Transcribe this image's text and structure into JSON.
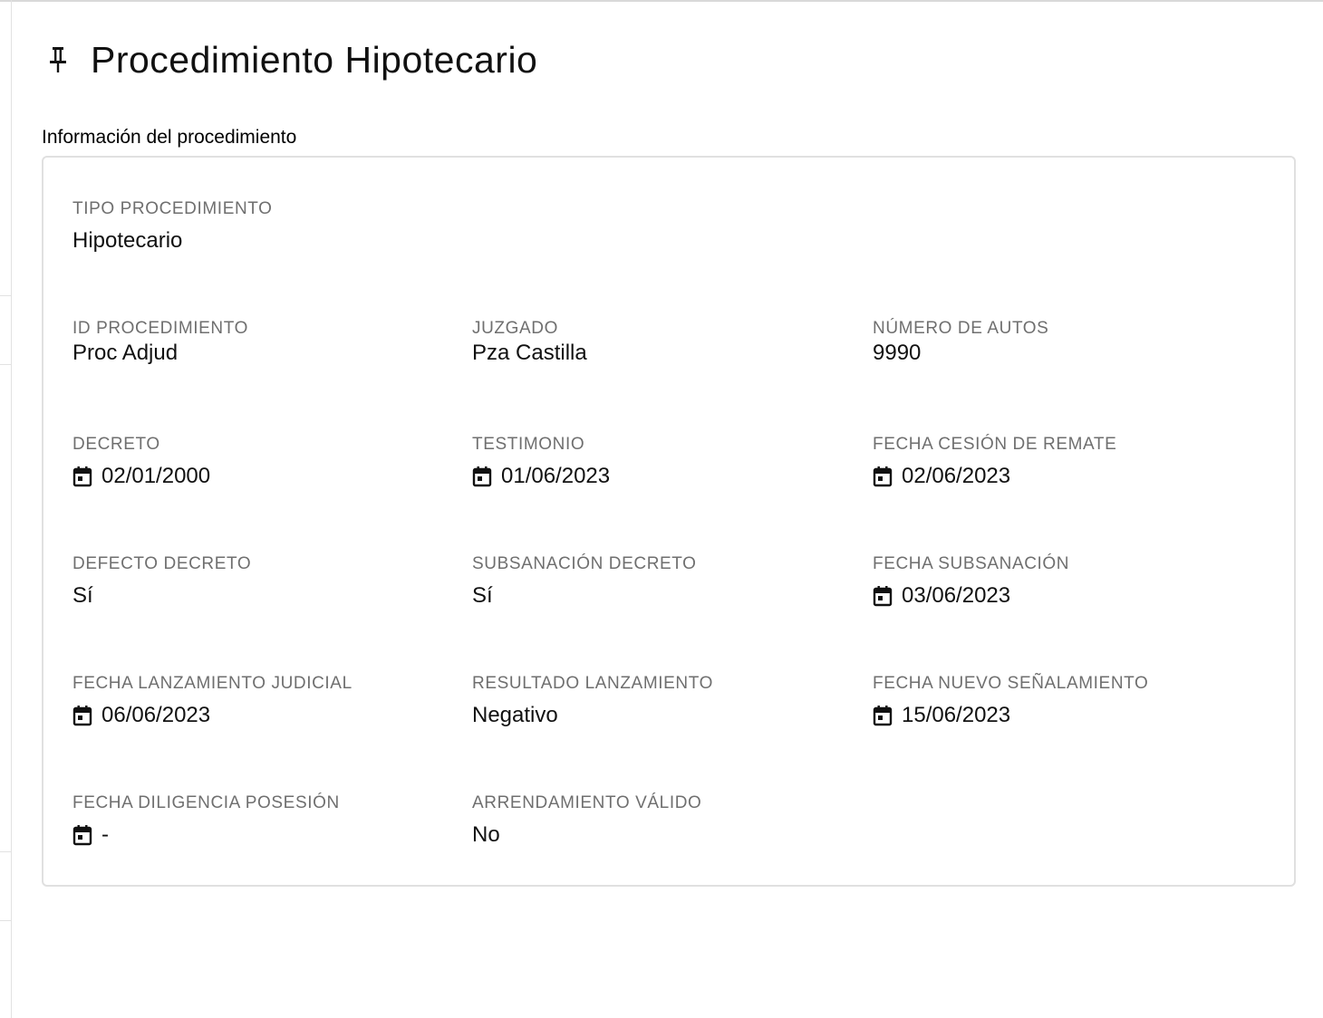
{
  "page": {
    "title": "Procedimiento Hipotecario",
    "title_icon": "pin-icon"
  },
  "section": {
    "label": "Información del procedimiento"
  },
  "fields": {
    "tipo_procedimiento": {
      "label": "TIPO PROCEDIMIENTO",
      "value": "Hipotecario"
    },
    "id_procedimiento": {
      "label": "ID PROCEDIMIENTO",
      "value": "Proc Adjud"
    },
    "juzgado": {
      "label": "JUZGADO",
      "value": "Pza Castilla"
    },
    "numero_autos": {
      "label": "NÚMERO DE AUTOS",
      "value": "9990"
    },
    "decreto": {
      "label": "DECRETO",
      "value": "02/01/2000",
      "icon": "calendar-icon"
    },
    "testimonio": {
      "label": "TESTIMONIO",
      "value": "01/06/2023",
      "icon": "calendar-icon"
    },
    "fecha_cesion_remate": {
      "label": "FECHA CESIÓN DE REMATE",
      "value": "02/06/2023",
      "icon": "calendar-icon"
    },
    "defecto_decreto": {
      "label": "DEFECTO DECRETO",
      "value": "Sí"
    },
    "subsanacion_decreto": {
      "label": "SUBSANACIÓN DECRETO",
      "value": "Sí"
    },
    "fecha_subsanacion": {
      "label": "FECHA SUBSANACIÓN",
      "value": "03/06/2023",
      "icon": "calendar-icon"
    },
    "fecha_lanzamiento_judicial": {
      "label": "FECHA LANZAMIENTO JUDICIAL",
      "value": "06/06/2023",
      "icon": "calendar-icon"
    },
    "resultado_lanzamiento": {
      "label": "RESULTADO LANZAMIENTO",
      "value": "Negativo"
    },
    "fecha_nuevo_senalamiento": {
      "label": "FECHA NUEVO SEÑALAMIENTO",
      "value": "15/06/2023",
      "icon": "calendar-icon"
    },
    "fecha_diligencia_posesion": {
      "label": "FECHA DILIGENCIA POSESIÓN",
      "value": "-",
      "icon": "calendar-icon"
    },
    "arrendamiento_valido": {
      "label": "ARRENDAMIENTO VÁLIDO",
      "value": "No"
    }
  },
  "colors": {
    "label_gray": "#6f6f6f",
    "value_text": "#111111",
    "card_border": "#e0e0e0"
  }
}
